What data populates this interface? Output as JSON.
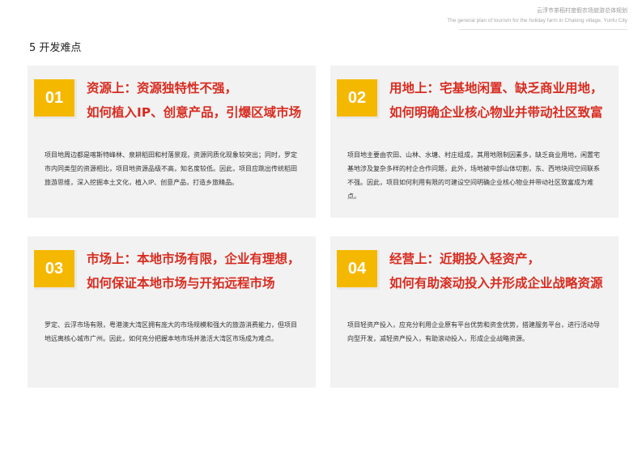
{
  "header": {
    "title_cn": "云浮市茶稻村度假农场旅游总体规划",
    "title_en": "The general plan of tourism for the holiday farm in Chalong village, Yunfu City"
  },
  "section_title": "5 开发难点",
  "cards": [
    {
      "number": "01",
      "title_line1": "资源上：资源独特性不强，",
      "title_line2": "如何植入IP、创意产品，引爆区域市场",
      "body": "项目地周边都是喀斯特峰林、泉耕稻田和村落景观，资源同质化现象较突出；同时，罗定市内同类型的资源相比，项目地资源品级不高，知名度较低。因此，项目应跳出传统稻田旅游思维，深入挖掘本土文化，植入IP、创意产品，打造乡旅精品。"
    },
    {
      "number": "02",
      "title_line1": "用地上：宅基地闲置、缺乏商业用地，",
      "title_line2": "如何明确企业核心物业并带动社区致富",
      "body": "项目地主要由农田、山林、水塘、村庄组成，其用地限制因素多，缺乏商业用地，闲置宅基地涉及复杂多样的村企合作问题，此外，场地被中部山体切割，东、西地块间空间联系不强。因此，项目如何利用有限的可建设空间明确企业核心物业并带动社区致富成为难点。"
    },
    {
      "number": "03",
      "title_line1": "市场上：本地市场有限，企业有理想，",
      "title_line2": "如何保证本地市场与开拓远程市场",
      "body": "罗定、云浮市场有限，粤港澳大湾区拥有庞大的市场规模和强大的旅游消费能力，但项目地远离核心城市广州。因此，如何充分把握本地市场并激活大湾区市场成为难点。"
    },
    {
      "number": "04",
      "title_line1": "经营上：近期投入轻资产，",
      "title_line2": "如何有助滚动投入并形成企业战略资源",
      "body": "项目轻资产投入，应充分利用企业原有平台优势和资金优势，搭建服务平台，进行活动导向型开发，减轻资产投入，有助滚动投入，形成企业战略资源。"
    }
  ],
  "colors": {
    "accent_yellow": "#f5b800",
    "title_red": "#d82c20",
    "card_bg": "#f2f2f2"
  }
}
